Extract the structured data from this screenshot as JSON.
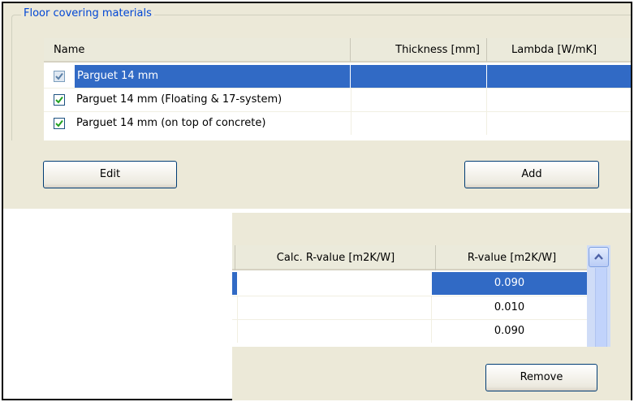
{
  "group": {
    "title": "Floor covering materials"
  },
  "top_list": {
    "headers": {
      "name": "Name",
      "thickness": "Thickness [mm]",
      "lambda": "Lambda [W/mK]"
    },
    "rows": [
      {
        "name": "Parguet 14 mm",
        "checked": true,
        "selected": true
      },
      {
        "name": "Parguet 14 mm (Floating & 17-system)",
        "checked": true,
        "selected": false
      },
      {
        "name": "Parguet 14 mm (on top of concrete)",
        "checked": true,
        "selected": false
      }
    ]
  },
  "buttons": {
    "edit": "Edit",
    "add": "Add",
    "remove": "Remove"
  },
  "bottom_list": {
    "headers": {
      "calc_r": "Calc. R-value [m2K/W]",
      "r_value": "R-value [m2K/W]"
    },
    "rows": [
      {
        "calc_r": "",
        "r_value": "0.090",
        "selected": true
      },
      {
        "calc_r": "",
        "r_value": "0.010",
        "selected": false
      },
      {
        "calc_r": "",
        "r_value": "0.090",
        "selected": false
      }
    ]
  },
  "colors": {
    "selection": "#316ac5",
    "group_title": "#0046d5",
    "dialog_bg": "#ece9d8",
    "check_green": "#21a121"
  },
  "icons": {
    "checkbox": "checkmark-icon",
    "scroll_up": "chevron-up-icon"
  }
}
